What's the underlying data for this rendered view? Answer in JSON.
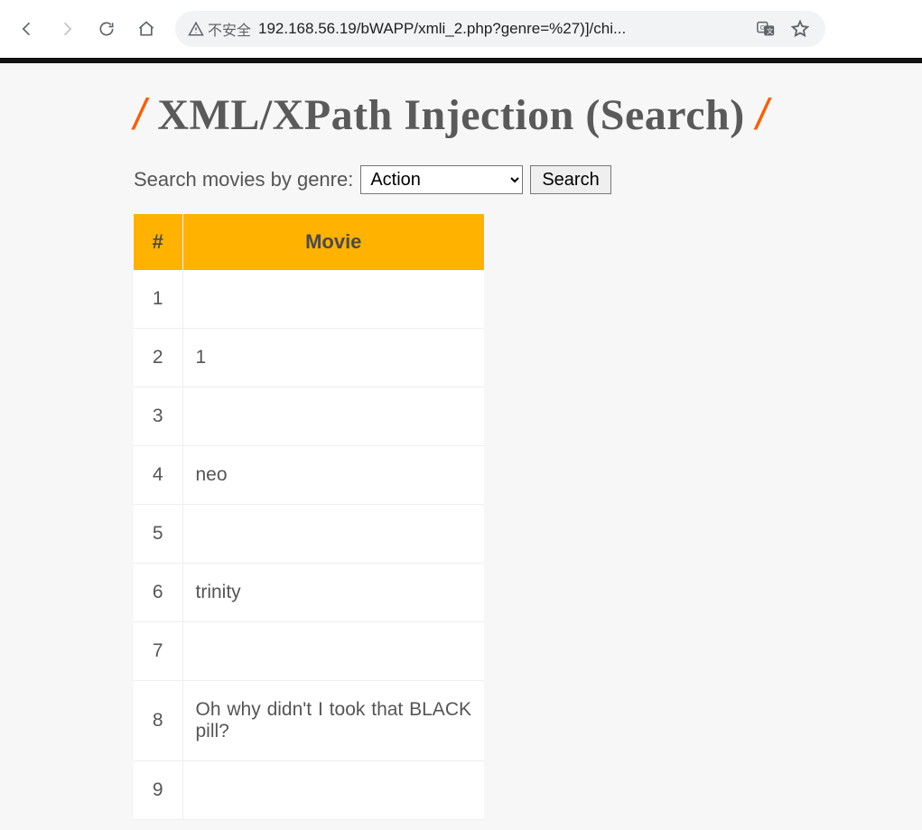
{
  "browser": {
    "security_label": "不安全",
    "url": "192.168.56.19/bWAPP/xmli_2.php?genre=%27)]/chi..."
  },
  "page": {
    "title": "XML/XPath Injection (Search)",
    "search_label": "Search movies by genre:",
    "genre_selected": "Action",
    "search_button": "Search"
  },
  "table": {
    "headers": {
      "num": "#",
      "movie": "Movie"
    },
    "rows": [
      {
        "n": "1",
        "movie": ""
      },
      {
        "n": "2",
        "movie": "1"
      },
      {
        "n": "3",
        "movie": ""
      },
      {
        "n": "4",
        "movie": "neo"
      },
      {
        "n": "5",
        "movie": ""
      },
      {
        "n": "6",
        "movie": "trinity"
      },
      {
        "n": "7",
        "movie": ""
      },
      {
        "n": "8",
        "movie": "Oh why didn't I took that BLACK pill?"
      },
      {
        "n": "9",
        "movie": ""
      }
    ]
  }
}
